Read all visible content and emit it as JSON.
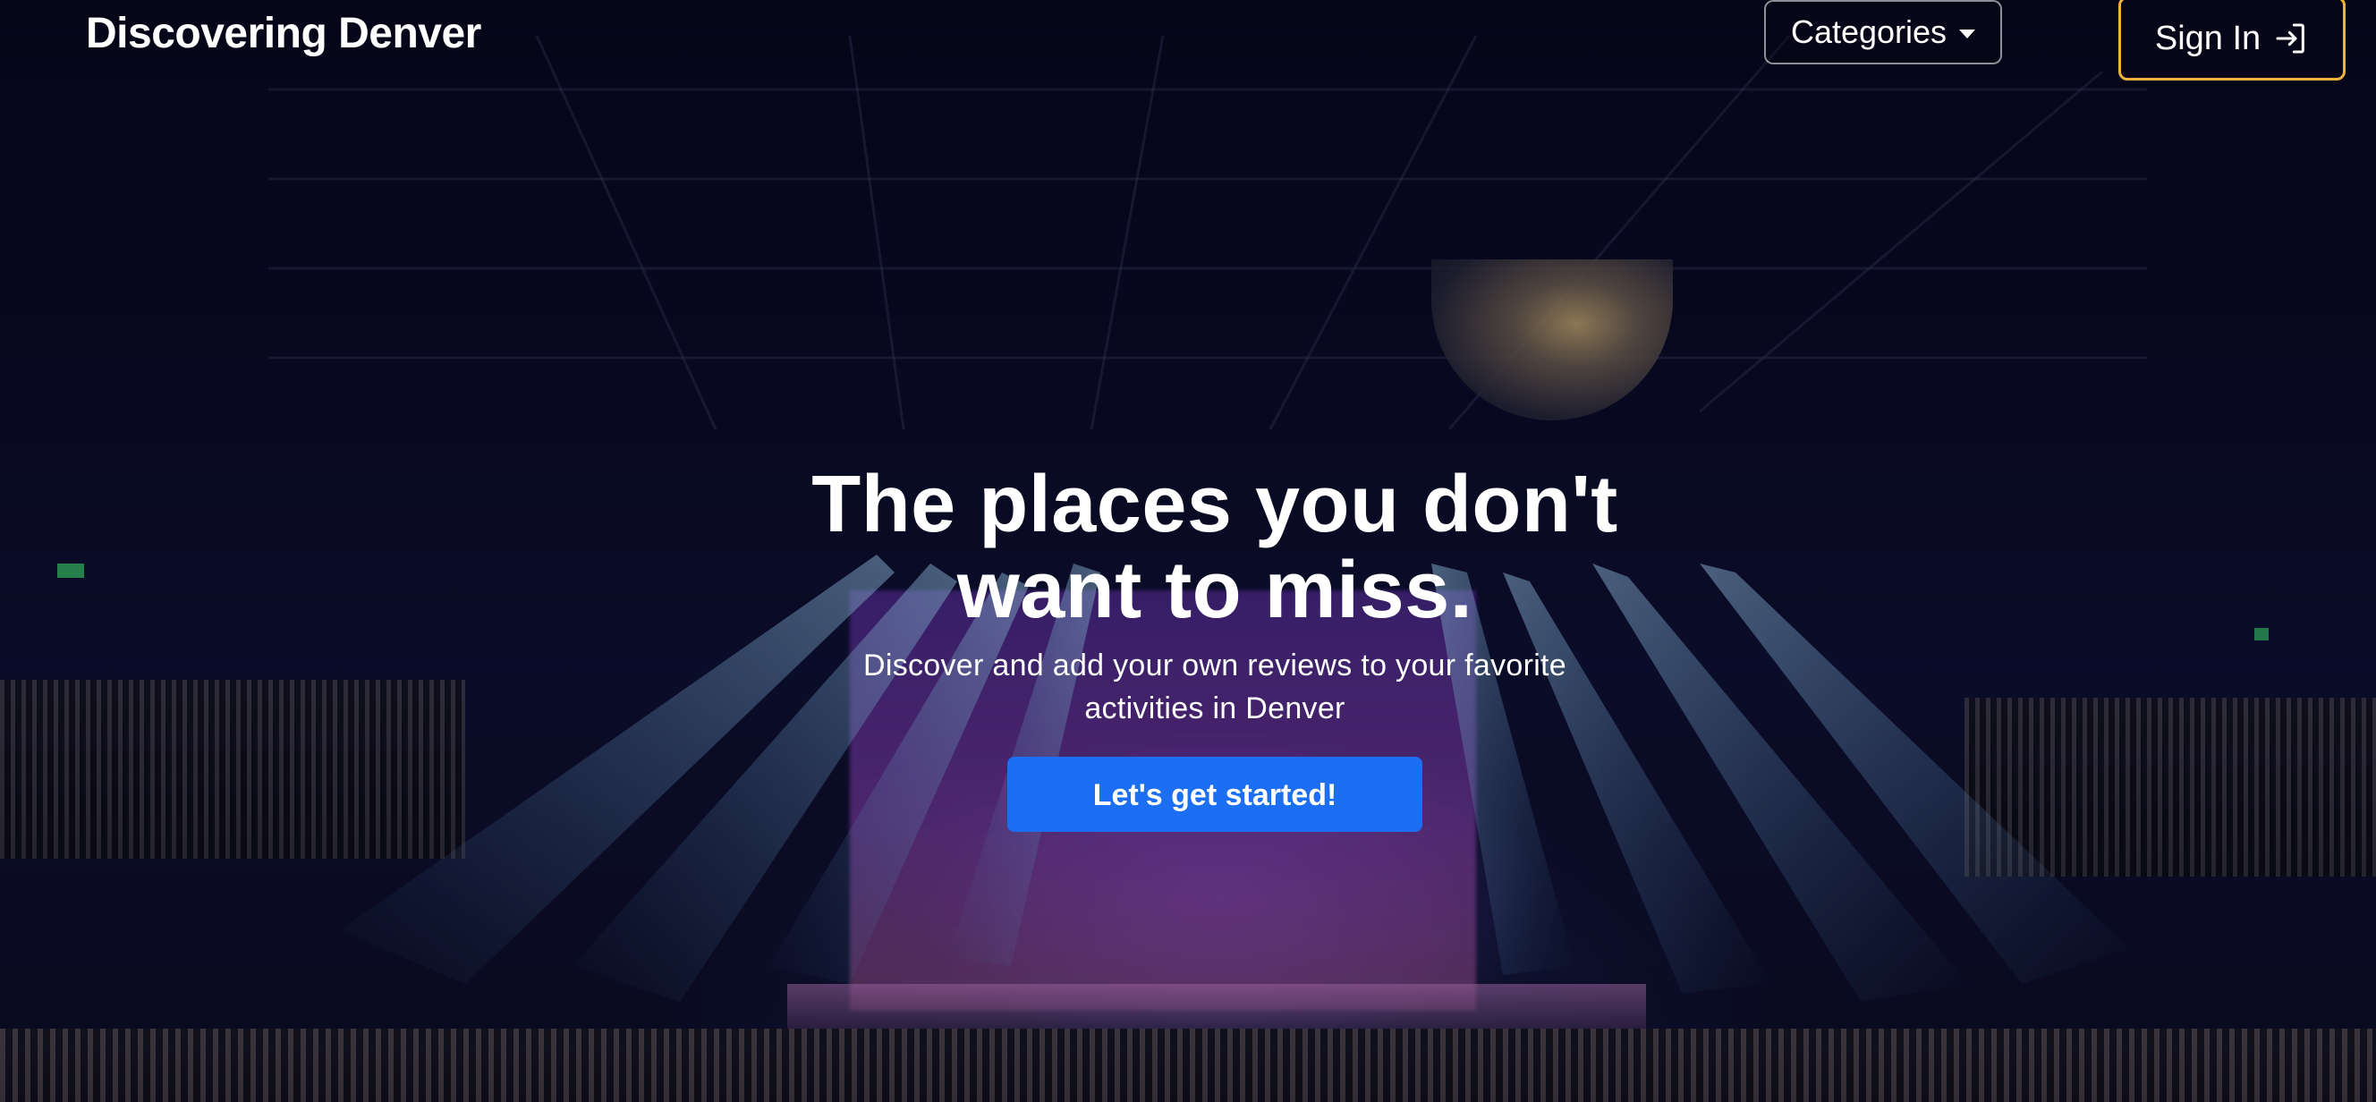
{
  "nav": {
    "brand": "Discovering Denver",
    "categories_label": "Categories",
    "signin_label": "Sign In"
  },
  "hero": {
    "headline_line1": "The places you don't",
    "headline_line2": "want to miss.",
    "subheadline": "Discover and add your own reviews to your favorite activities in Denver",
    "cta_label": "Let's get started!"
  },
  "icons": {
    "categories": "chevron-down-icon",
    "signin": "sign-in-icon"
  },
  "colors": {
    "primary_button": "#1c6ef2",
    "signin_border": "#f0b23c",
    "text": "#ffffff"
  }
}
